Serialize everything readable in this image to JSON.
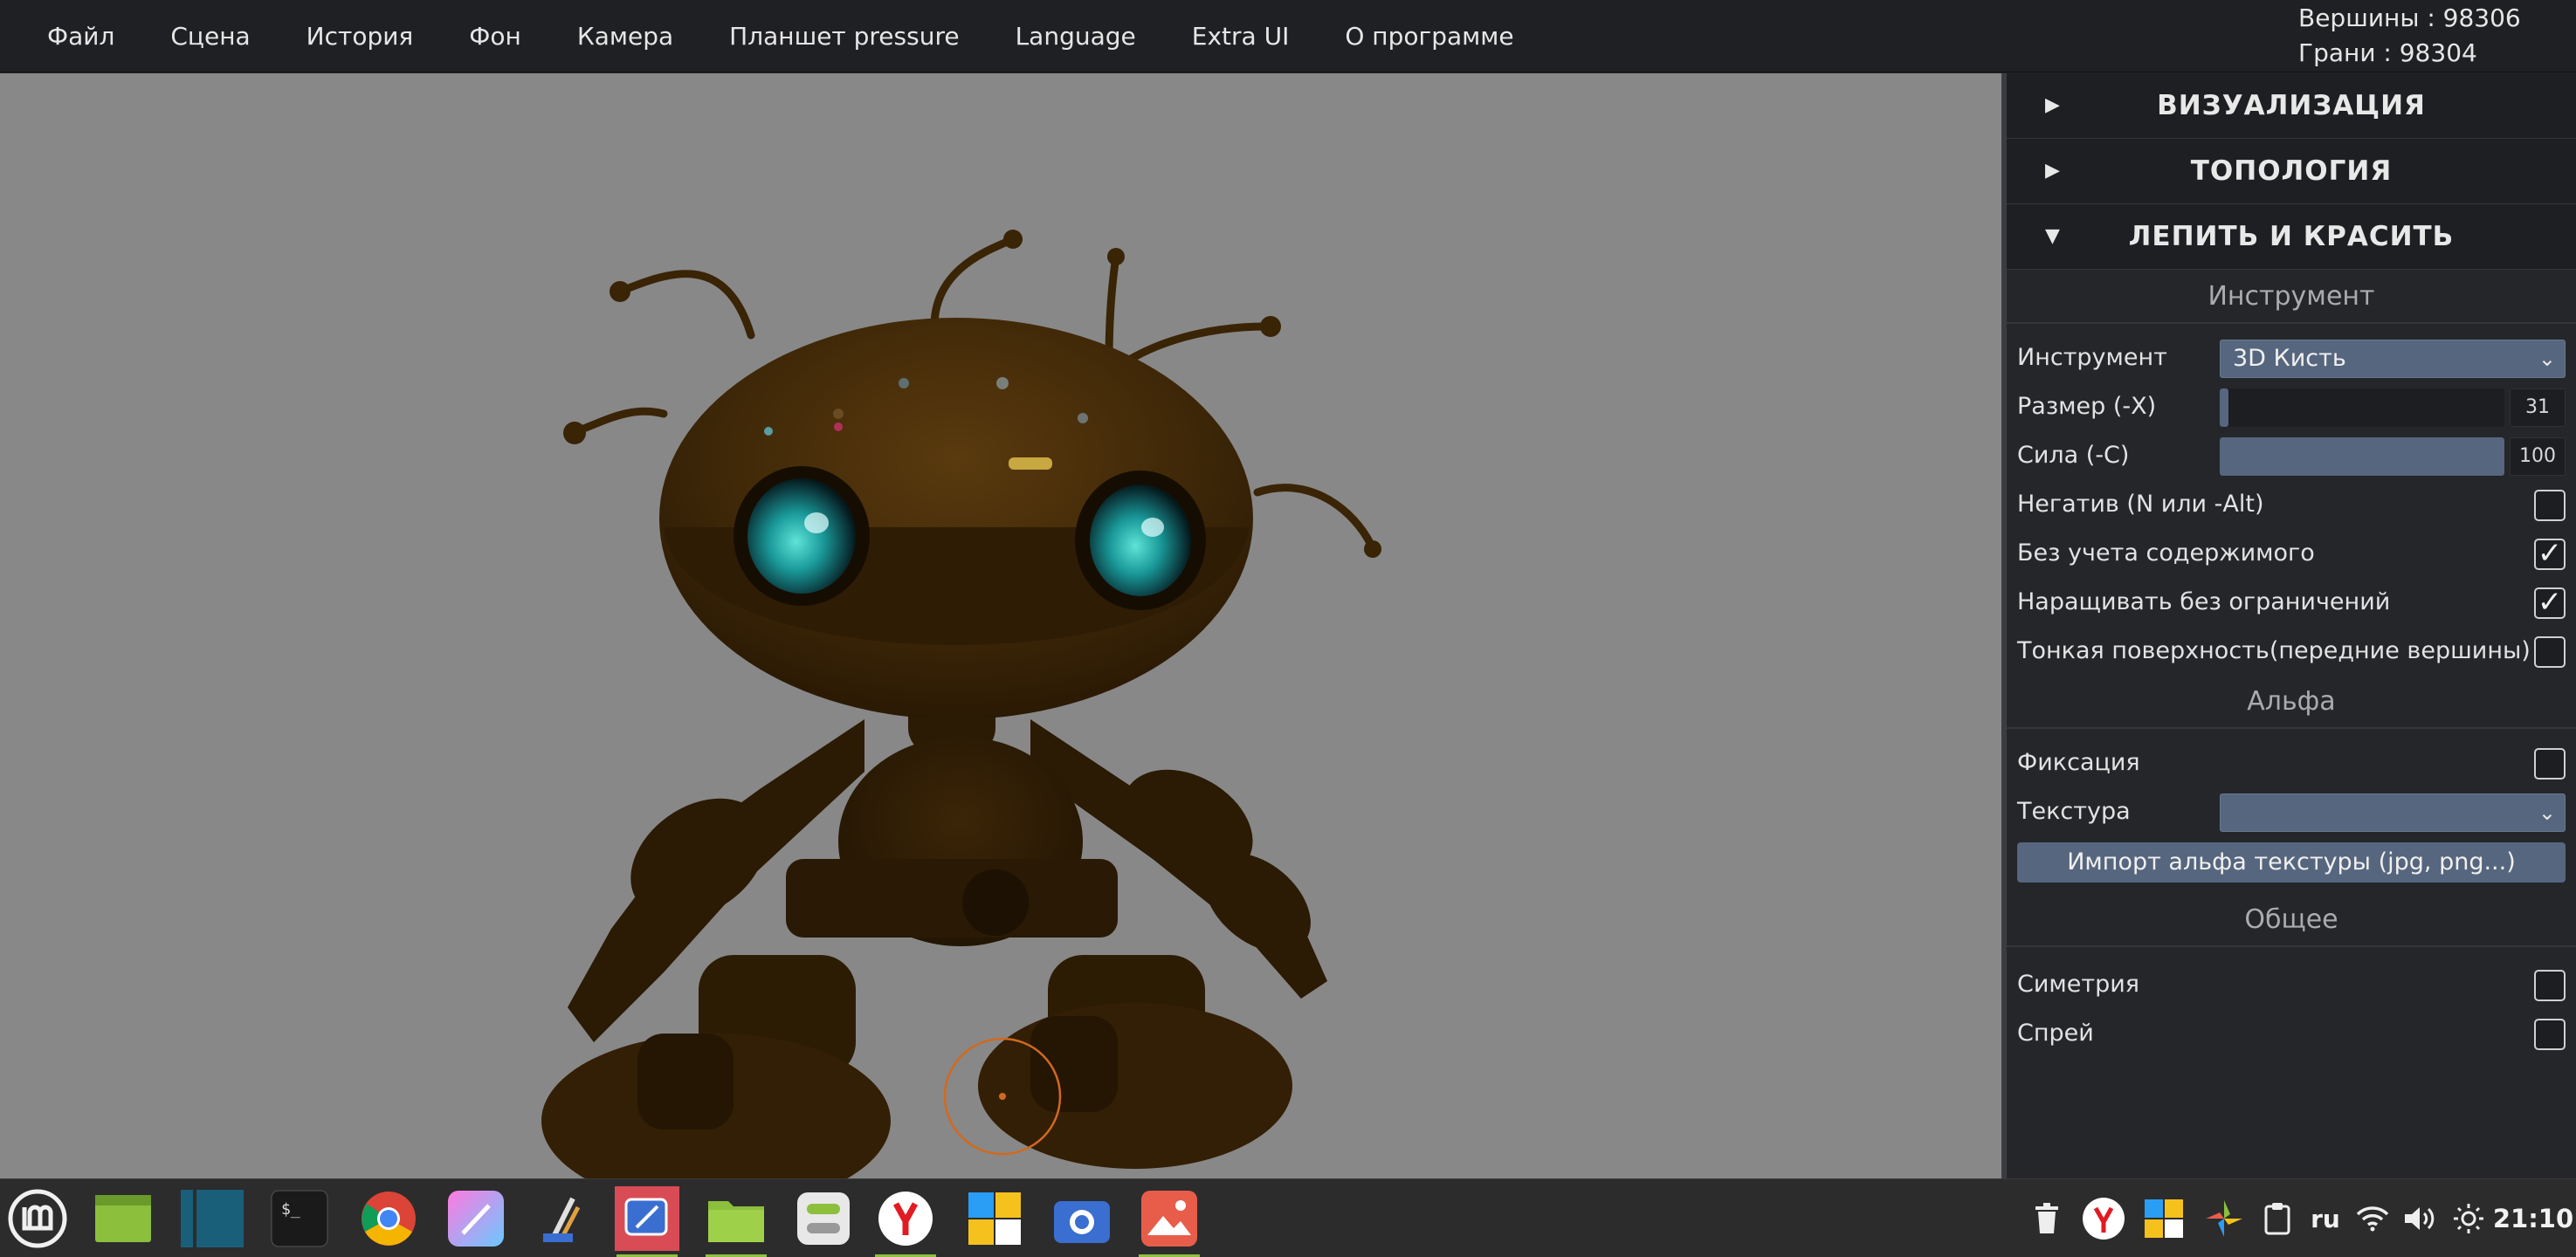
{
  "menu": {
    "items": [
      "Файл",
      "Сцена",
      "История",
      "Фон",
      "Камера",
      "Планшет pressure",
      "Language",
      "Extra UI",
      "О программе"
    ]
  },
  "stats": {
    "vertices": "Вершины : 98306",
    "faces": "Грани : 98304"
  },
  "panel": {
    "sections": [
      {
        "title": "ВИЗУАЛИЗАЦИЯ",
        "arrow": "▶",
        "expanded": false
      },
      {
        "title": "ТОПОЛОГИЯ",
        "arrow": "▶",
        "expanded": false
      },
      {
        "title": "ЛЕПИТЬ И КРАСИТЬ",
        "arrow": "▼",
        "expanded": true
      }
    ],
    "tool_heading": "Инструмент",
    "tool": {
      "label": "Инструмент",
      "value": "3D Кисть"
    },
    "size": {
      "label": "Размер (-X)",
      "value": "31",
      "fraction": 0.03
    },
    "strength": {
      "label": "Сила (-C)",
      "value": "100",
      "fraction": 1.0
    },
    "negative": {
      "label": "Негатив (N или -Alt)",
      "checked": false
    },
    "ignore_content": {
      "label": "Без учета содержимого",
      "checked": true
    },
    "grow_unlimited": {
      "label": "Наращивать без ограничений",
      "checked": true
    },
    "thin_surface": {
      "label": "Тонкая поверхность(передние вершины)",
      "checked": false
    },
    "alpha_heading": "Альфа",
    "lock": {
      "label": "Фиксация",
      "checked": false
    },
    "texture": {
      "label": "Текстура",
      "value": ""
    },
    "import_button": "Импорт альфа текстуры (jpg, png...)",
    "general_heading": "Общее",
    "symmetry": {
      "label": "Симетрия",
      "checked": false
    },
    "spray": {
      "label": "Спрей",
      "checked": false
    }
  },
  "taskbar": {
    "apps": [
      "mint-menu",
      "show-desktop",
      "workspace-switcher",
      "terminal",
      "chrome",
      "drawing-app",
      "paint-tools",
      "sculpt-app",
      "files",
      "settings",
      "yandex-browser",
      "office-app",
      "screenshot",
      "image-viewer"
    ],
    "lang": "ru",
    "clock": "21:10"
  },
  "colors": {
    "viewport_bg": "#888888",
    "model_base": "#3d2608",
    "accent_select": "#56667e",
    "brush_cursor": "#d2691e"
  }
}
